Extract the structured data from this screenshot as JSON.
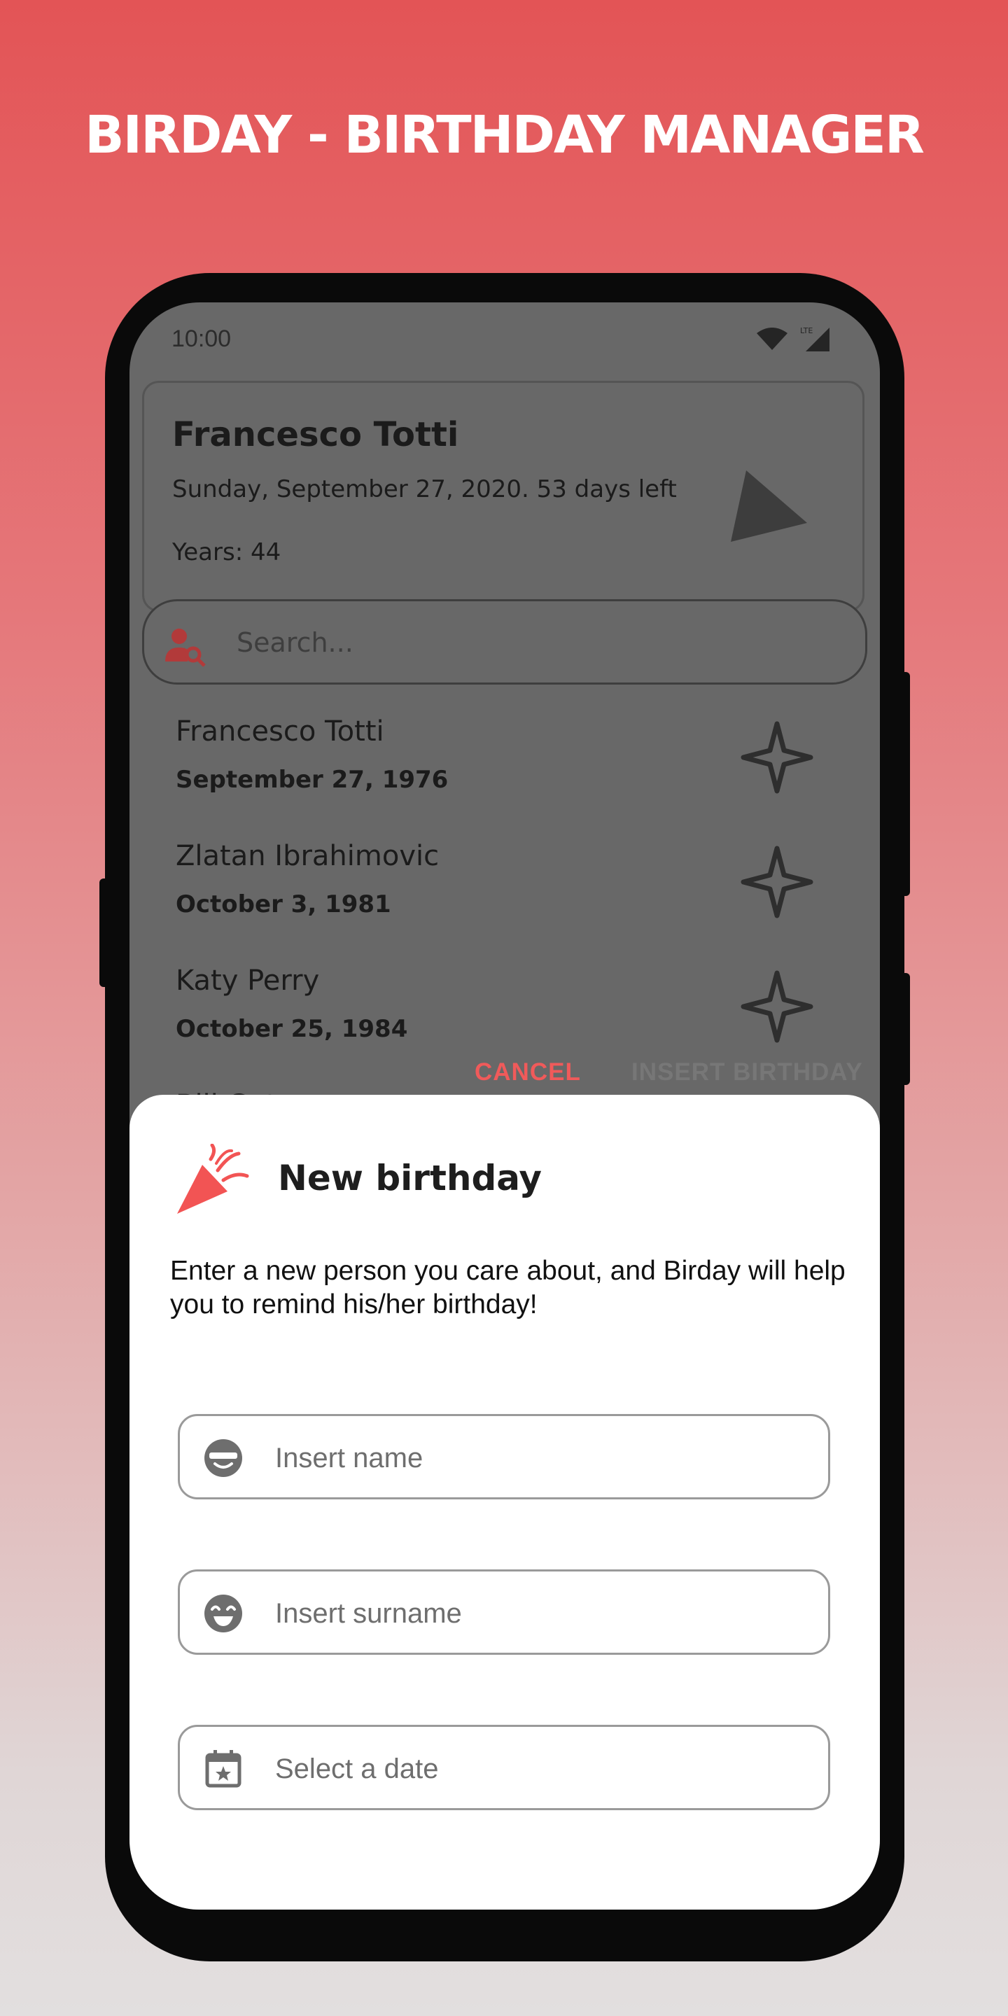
{
  "banner": {
    "title": "BIRDAY - BIRTHDAY MANAGER"
  },
  "status_bar": {
    "time": "10:00",
    "network": "LTE"
  },
  "upcoming_card": {
    "name": "Francesco Totti",
    "date_text": "Sunday, September 27, 2020. 53 days left",
    "years": "Years: 44"
  },
  "search": {
    "placeholder": "Search..."
  },
  "birthdays": [
    {
      "name": "Francesco Totti",
      "date": "September 27, 1976"
    },
    {
      "name": "Zlatan Ibrahimovic",
      "date": "October 3, 1981"
    },
    {
      "name": "Katy Perry",
      "date": "October 25, 1984"
    },
    {
      "name": "Bill Gates",
      "date": ""
    }
  ],
  "dialog": {
    "title": "New birthday",
    "description": "Enter a new person you care about, and Birday will help you to remind his/her birthday!",
    "name_placeholder": "Insert name",
    "surname_placeholder": "Insert surname",
    "date_placeholder": "Select a date",
    "cancel_label": "CANCEL",
    "insert_label": "INSERT BIRTHDAY"
  },
  "colors": {
    "accent": "#f05a5a",
    "dialog_icon": "#f25454",
    "disabled_text": "#777777"
  }
}
